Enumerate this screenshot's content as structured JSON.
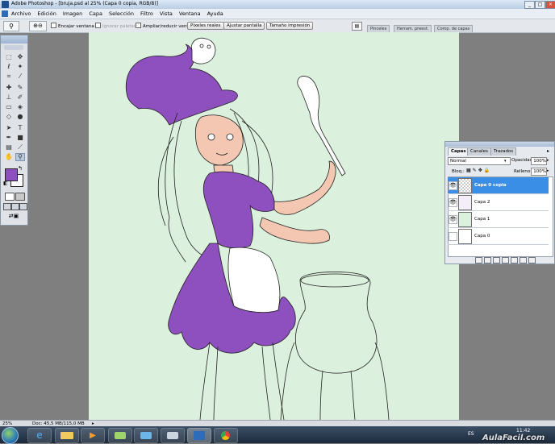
{
  "window": {
    "title": "Adobe Photoshop - [bruja.psd al 25% (Capa 0 copia, RGB/8)]",
    "controls": [
      "_",
      "□",
      "×"
    ]
  },
  "menu": [
    "Archivo",
    "Edición",
    "Imagen",
    "Capa",
    "Selección",
    "Filtro",
    "Vista",
    "Ventana",
    "Ayuda"
  ],
  "options": {
    "encajar": "Encajar ventana",
    "ignorar": "Ignorar paletas",
    "ampliar": "Ampliar/reducir vent.",
    "pixeles": "Píxeles reales",
    "ajustar": "Ajustar pantalla",
    "impresion": "Tamaño impresión",
    "palette_tabs": [
      "Pinceles",
      "Herram. preest.",
      "Comp. de capas"
    ]
  },
  "colors": {
    "foreground": "#8e4fbf",
    "background": "#ffffff",
    "canvas": "#dbf0dd",
    "selected_layer": "#3a8ee6"
  },
  "layers_panel": {
    "tabs": [
      "Capas",
      "Canales",
      "Trazados"
    ],
    "blend_mode": "Normal",
    "opacity_label": "Opacidad:",
    "opacity": "100%",
    "lock_label": "Bloq.:",
    "fill_label": "Relleno:",
    "fill": "100%",
    "layers": [
      {
        "name": "Capa 0 copia",
        "visible": true,
        "selected": true
      },
      {
        "name": "Capa 2",
        "visible": true,
        "selected": false
      },
      {
        "name": "Capa 1",
        "visible": true,
        "selected": false
      },
      {
        "name": "Capa 0",
        "visible": false,
        "selected": false
      }
    ]
  },
  "status": {
    "zoom": "25%",
    "doc": "Doc: 45,5 MB/115,0 MB"
  },
  "taskbar": {
    "lang": "ES",
    "time": "11:42",
    "watermark": "AulaFacil.com"
  }
}
